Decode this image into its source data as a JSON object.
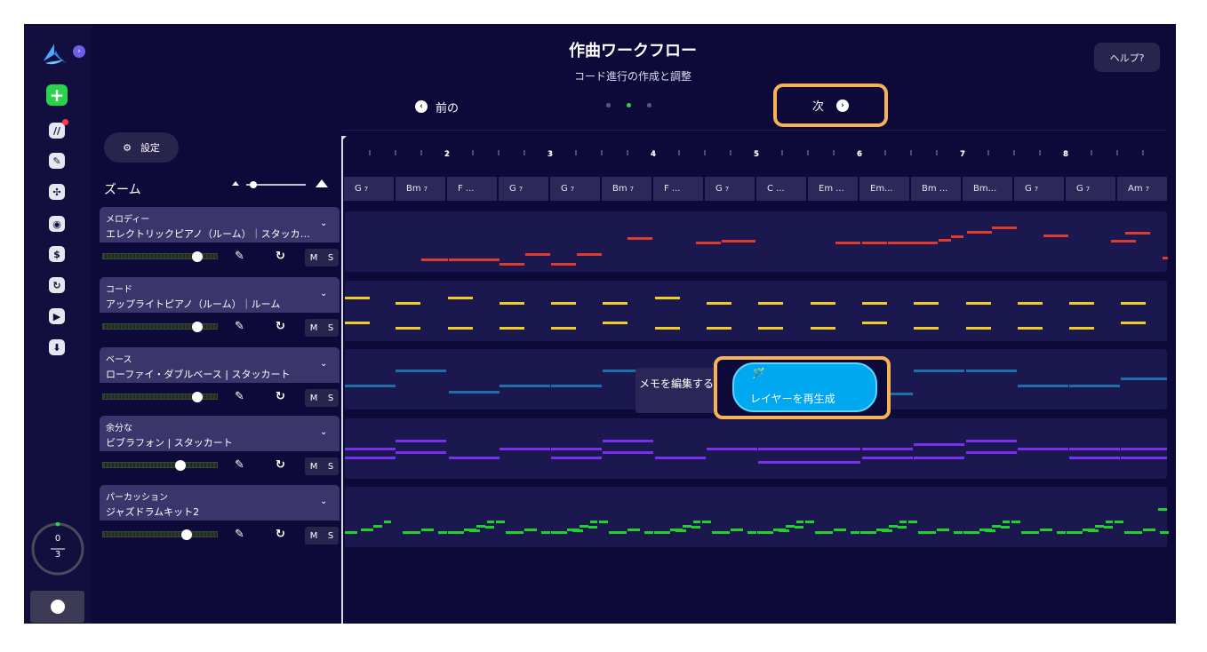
{
  "header": {
    "title": "作曲ワークフロー",
    "subtitle": "コード進行の作成と調整",
    "help_label": "ヘルプ?",
    "prev_label": "前の",
    "next_label": "次",
    "step_indicator": {
      "total": 3,
      "current": 2
    }
  },
  "sidebar": {
    "counter_top": "0",
    "counter_bottom": "3",
    "items": [
      "add-icon",
      "notes-icon",
      "pen-icon",
      "fan-icon",
      "radio-icon",
      "dollar-icon",
      "refresh-icon",
      "play-icon",
      "download-icon"
    ]
  },
  "controls": {
    "settings_label": "設定",
    "zoom_label": "ズーム",
    "zoom_level": 0.12
  },
  "tracks": [
    {
      "category": "メロディー",
      "instrument": "エレクトリックピアノ（ルーム）｜スタッカート",
      "volume": 0.82,
      "mute_label": "M",
      "solo_label": "S"
    },
    {
      "category": "コード",
      "instrument": "アップライトピアノ（ルーム）｜ルーム",
      "volume": 0.82,
      "mute_label": "M",
      "solo_label": "S"
    },
    {
      "category": "ベース",
      "instrument": "ローファイ・ダブルベース | スタッカート",
      "volume": 0.82,
      "mute_label": "M",
      "solo_label": "S"
    },
    {
      "category": "余分な",
      "instrument": "ビブラフォン | スタッカート",
      "volume": 0.68,
      "mute_label": "M",
      "solo_label": "S"
    },
    {
      "category": "パーカッション",
      "instrument": "ジャズドラムキット2",
      "volume": 0.73,
      "mute_label": "M",
      "solo_label": "S"
    }
  ],
  "timeline": {
    "bar_numbers": [
      "2",
      "3",
      "4",
      "5",
      "6",
      "7",
      "8"
    ],
    "chords": [
      {
        "name": "G",
        "ext": "7"
      },
      {
        "name": "Bm",
        "ext": "7"
      },
      {
        "name": "F ...",
        "ext": ""
      },
      {
        "name": "G",
        "ext": "7"
      },
      {
        "name": "G",
        "ext": "7"
      },
      {
        "name": "Bm",
        "ext": "7"
      },
      {
        "name": "F ...",
        "ext": ""
      },
      {
        "name": "G",
        "ext": "7"
      },
      {
        "name": "C ...",
        "ext": ""
      },
      {
        "name": "Em ...",
        "ext": ""
      },
      {
        "name": "Em...",
        "ext": ""
      },
      {
        "name": "Bm ...",
        "ext": ""
      },
      {
        "name": "Bm...",
        "ext": ""
      },
      {
        "name": "G",
        "ext": "7"
      },
      {
        "name": "G",
        "ext": "7"
      },
      {
        "name": "Am",
        "ext": "7"
      }
    ]
  },
  "overlay": {
    "memo_label": "メモを編集する",
    "regenerate_label": "レイヤーを再生成"
  },
  "colors": {
    "background": "#0d0a3a",
    "accent_highlight": "#f6b356",
    "melody": "#e03a2e",
    "chords": "#f0cc24",
    "bass": "#1f6fa8",
    "extra": "#7a2ef0",
    "percussion": "#1fd12a",
    "regenerate": "#00a8f0"
  }
}
